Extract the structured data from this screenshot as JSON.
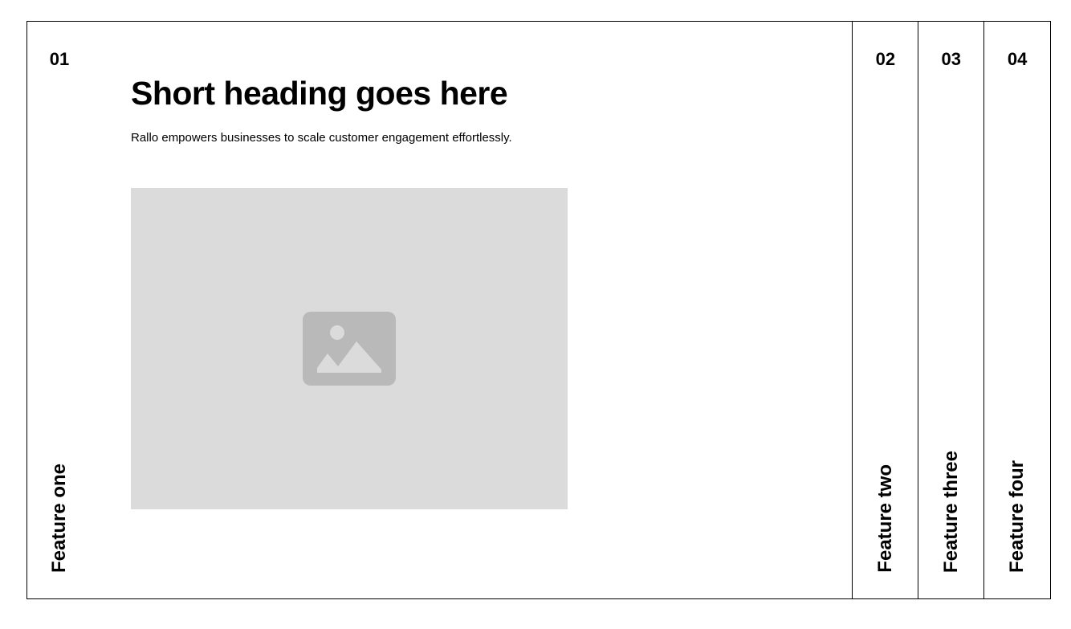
{
  "features": [
    {
      "number": "01",
      "label": "Feature one",
      "active": true,
      "heading": "Short heading goes here",
      "description": "Rallo empowers businesses to scale customer engagement effortlessly.",
      "image_icon": "image-placeholder-icon"
    },
    {
      "number": "02",
      "label": "Feature two",
      "active": false
    },
    {
      "number": "03",
      "label": "Feature three",
      "active": false
    },
    {
      "number": "04",
      "label": "Feature four",
      "active": false
    }
  ],
  "colors": {
    "border": "#000000",
    "placeholder_bg": "#dbdbdb",
    "placeholder_icon": "#b9b9b9"
  }
}
